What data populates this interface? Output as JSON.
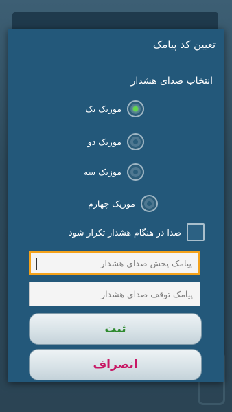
{
  "dialog": {
    "title": "تعیین کد پیامک",
    "alarm_sound_section": "انتخاب صدای هشدار",
    "radio_options": [
      {
        "label": "موزیک یک",
        "checked": true
      },
      {
        "label": "موزیک دو",
        "checked": false
      },
      {
        "label": "موزیک سه",
        "checked": false
      },
      {
        "label": "موزیک چهارم",
        "checked": false
      }
    ],
    "repeat_checkbox": {
      "label": "صدا در هنگام هشدار تکرار شود",
      "checked": false
    },
    "play_sms_input": {
      "value": "",
      "placeholder": "پیامک پخش صدای هشدار"
    },
    "stop_sms_input": {
      "value": "",
      "placeholder": "پیامک توقف صدای هشدار"
    },
    "save_label": "ثبت",
    "cancel_label": "انصراف"
  },
  "colors": {
    "dialog_bg": "#23587a",
    "focus_border": "#f4a21a",
    "save_text": "#2f8a2f",
    "cancel_text": "#c81865",
    "radio_checked": "#62d64a"
  }
}
